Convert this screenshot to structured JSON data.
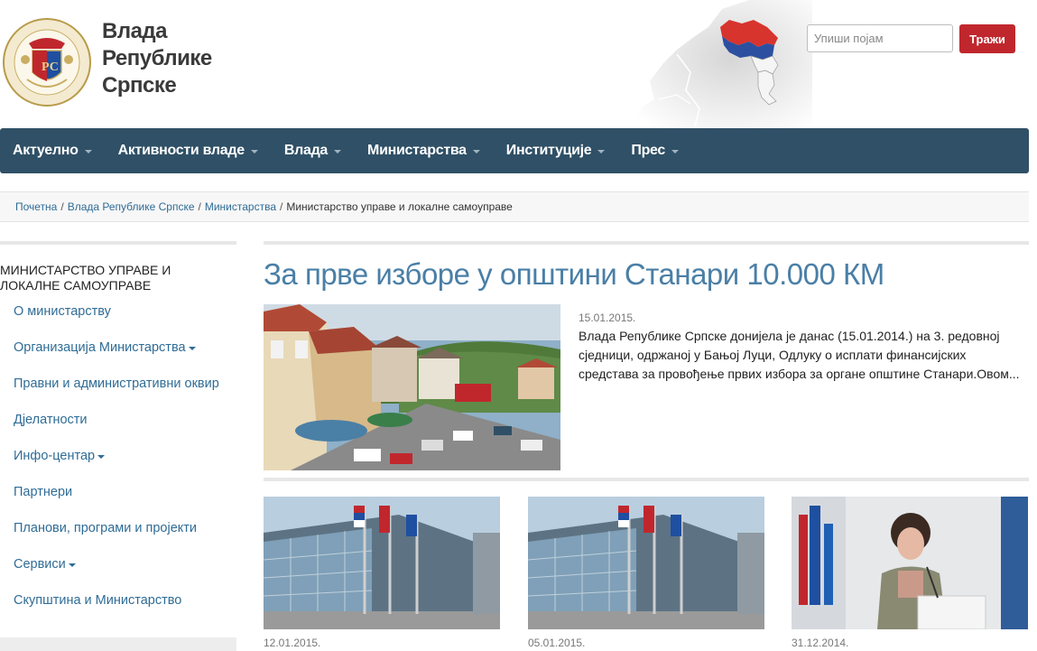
{
  "header": {
    "title_line1": "Влада",
    "title_line2": "Републике",
    "title_line3": "Српске",
    "search_placeholder": "Упиши појам",
    "search_button": "Тражи"
  },
  "nav": {
    "items": [
      {
        "label": "Актуелно"
      },
      {
        "label": "Активности владе"
      },
      {
        "label": "Влада"
      },
      {
        "label": "Министарства"
      },
      {
        "label": "Институције"
      },
      {
        "label": "Прес"
      }
    ]
  },
  "breadcrumb": {
    "items": [
      "Почетна",
      "Влада Републике Српске",
      "Министарства"
    ],
    "current": "Министарство управе и локалне самоуправе"
  },
  "sidebar": {
    "title": "МИНИСТАРСТВО УПРАВЕ И ЛОКАЛНЕ САМОУПРАВЕ",
    "items": [
      {
        "label": "О министарству",
        "has_dropdown": false
      },
      {
        "label": "Организација Министарства",
        "has_dropdown": true
      },
      {
        "label": "Правни и административни оквир",
        "has_dropdown": false
      },
      {
        "label": "Дјелатности",
        "has_dropdown": false
      },
      {
        "label": "Инфо-центар",
        "has_dropdown": true
      },
      {
        "label": "Партнери",
        "has_dropdown": false
      },
      {
        "label": "Планови, програми и пројекти",
        "has_dropdown": false
      },
      {
        "label": "Сервиси",
        "has_dropdown": true
      },
      {
        "label": "Скупштина и Министарство",
        "has_dropdown": false
      }
    ]
  },
  "main": {
    "article": {
      "title": "За прве изборе у општини Станари 10.000 КМ",
      "date": "15.01.2015.",
      "excerpt": "Влада Републике Српске донијела је данас  (15.01.2014.) на 3. редовној сједници, одржаној у Бањој Луци, Одлуку о исплати финансијских средстава за провођење првих избора за органе општине Станари.Овом..."
    },
    "cards": [
      {
        "date": "12.01.2015."
      },
      {
        "date": "05.01.2015."
      },
      {
        "date": "31.12.2014."
      }
    ]
  },
  "colors": {
    "nav_bg": "#2f5066",
    "accent_red": "#c0272d",
    "link_blue": "#2f6c96",
    "title_blue": "#4a7fa6"
  }
}
